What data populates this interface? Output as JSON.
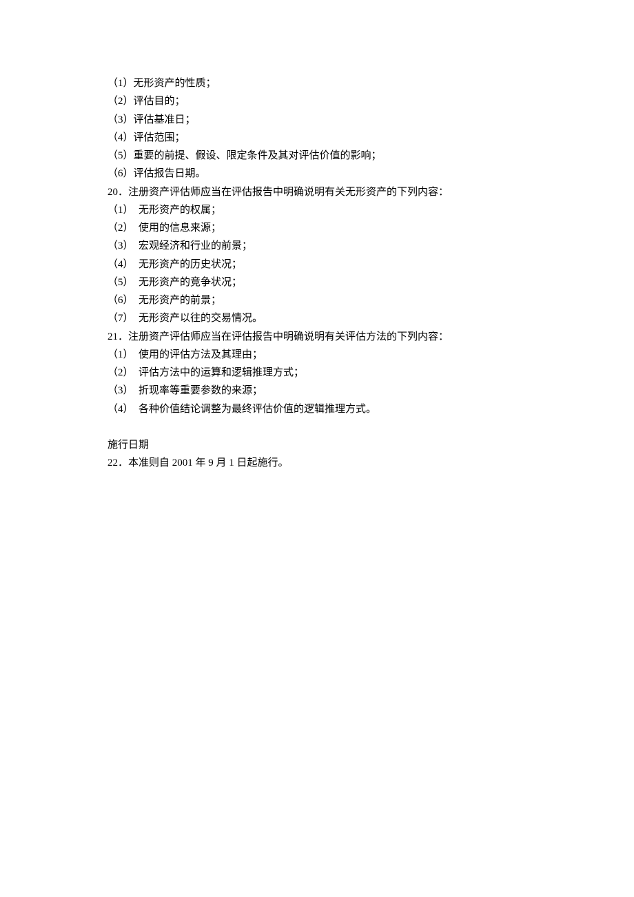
{
  "lines": [
    "（1）无形资产的性质；",
    "（2）评估目的；",
    "（3）评估基准日；",
    "（4）评估范围；",
    "（5）重要的前提、假设、限定条件及其对评估价值的影响；",
    "（6）评估报告日期。",
    "20．注册资产评估师应当在评估报告中明确说明有关无形资产的下列内容：",
    "（1）  无形资产的权属；",
    "（2）  使用的信息来源；",
    "（3）  宏观经济和行业的前景；",
    "（4）  无形资产的历史状况；",
    "（5）  无形资产的竞争状况；",
    "（6）  无形资产的前景；",
    "（7）  无形资产以往的交易情况。",
    "21．注册资产评估师应当在评估报告中明确说明有关评估方法的下列内容：",
    "（1）  使用的评估方法及其理由；",
    "（2）  评估方法中的运算和逻辑推理方式；",
    "（3）  折现率等重要参数的来源；",
    "（4）  各种价值结论调整为最终评估价值的逻辑推理方式。"
  ],
  "sectionHeading": "施行日期",
  "effectiveLine": "22．本准则自 2001 年 9 月 1 日起施行。"
}
